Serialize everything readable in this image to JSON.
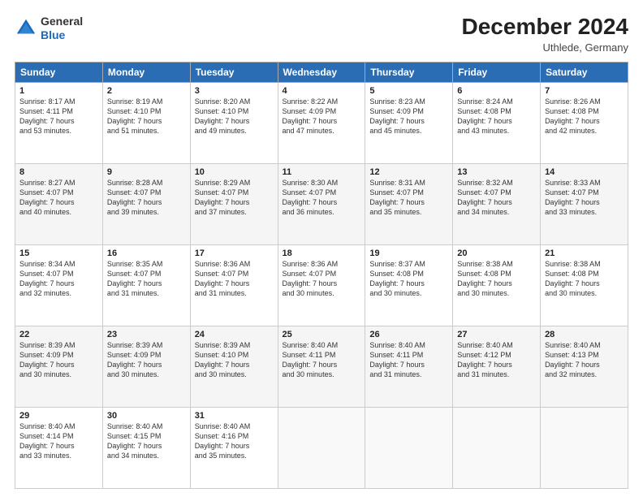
{
  "logo": {
    "line1": "General",
    "line2": "Blue"
  },
  "header": {
    "month": "December 2024",
    "location": "Uthlede, Germany"
  },
  "days": [
    "Sunday",
    "Monday",
    "Tuesday",
    "Wednesday",
    "Thursday",
    "Friday",
    "Saturday"
  ],
  "weeks": [
    [
      {
        "day": 1,
        "sunrise": "8:17 AM",
        "sunset": "4:11 PM",
        "daylight": "7 hours and 53 minutes."
      },
      {
        "day": 2,
        "sunrise": "8:19 AM",
        "sunset": "4:10 PM",
        "daylight": "7 hours and 51 minutes."
      },
      {
        "day": 3,
        "sunrise": "8:20 AM",
        "sunset": "4:10 PM",
        "daylight": "7 hours and 49 minutes."
      },
      {
        "day": 4,
        "sunrise": "8:22 AM",
        "sunset": "4:09 PM",
        "daylight": "7 hours and 47 minutes."
      },
      {
        "day": 5,
        "sunrise": "8:23 AM",
        "sunset": "4:09 PM",
        "daylight": "7 hours and 45 minutes."
      },
      {
        "day": 6,
        "sunrise": "8:24 AM",
        "sunset": "4:08 PM",
        "daylight": "7 hours and 43 minutes."
      },
      {
        "day": 7,
        "sunrise": "8:26 AM",
        "sunset": "4:08 PM",
        "daylight": "7 hours and 42 minutes."
      }
    ],
    [
      {
        "day": 8,
        "sunrise": "8:27 AM",
        "sunset": "4:07 PM",
        "daylight": "7 hours and 40 minutes."
      },
      {
        "day": 9,
        "sunrise": "8:28 AM",
        "sunset": "4:07 PM",
        "daylight": "7 hours and 39 minutes."
      },
      {
        "day": 10,
        "sunrise": "8:29 AM",
        "sunset": "4:07 PM",
        "daylight": "7 hours and 37 minutes."
      },
      {
        "day": 11,
        "sunrise": "8:30 AM",
        "sunset": "4:07 PM",
        "daylight": "7 hours and 36 minutes."
      },
      {
        "day": 12,
        "sunrise": "8:31 AM",
        "sunset": "4:07 PM",
        "daylight": "7 hours and 35 minutes."
      },
      {
        "day": 13,
        "sunrise": "8:32 AM",
        "sunset": "4:07 PM",
        "daylight": "7 hours and 34 minutes."
      },
      {
        "day": 14,
        "sunrise": "8:33 AM",
        "sunset": "4:07 PM",
        "daylight": "7 hours and 33 minutes."
      }
    ],
    [
      {
        "day": 15,
        "sunrise": "8:34 AM",
        "sunset": "4:07 PM",
        "daylight": "7 hours and 32 minutes."
      },
      {
        "day": 16,
        "sunrise": "8:35 AM",
        "sunset": "4:07 PM",
        "daylight": "7 hours and 31 minutes."
      },
      {
        "day": 17,
        "sunrise": "8:36 AM",
        "sunset": "4:07 PM",
        "daylight": "7 hours and 31 minutes."
      },
      {
        "day": 18,
        "sunrise": "8:36 AM",
        "sunset": "4:07 PM",
        "daylight": "7 hours and 30 minutes."
      },
      {
        "day": 19,
        "sunrise": "8:37 AM",
        "sunset": "4:08 PM",
        "daylight": "7 hours and 30 minutes."
      },
      {
        "day": 20,
        "sunrise": "8:38 AM",
        "sunset": "4:08 PM",
        "daylight": "7 hours and 30 minutes."
      },
      {
        "day": 21,
        "sunrise": "8:38 AM",
        "sunset": "4:08 PM",
        "daylight": "7 hours and 30 minutes."
      }
    ],
    [
      {
        "day": 22,
        "sunrise": "8:39 AM",
        "sunset": "4:09 PM",
        "daylight": "7 hours and 30 minutes."
      },
      {
        "day": 23,
        "sunrise": "8:39 AM",
        "sunset": "4:09 PM",
        "daylight": "7 hours and 30 minutes."
      },
      {
        "day": 24,
        "sunrise": "8:39 AM",
        "sunset": "4:10 PM",
        "daylight": "7 hours and 30 minutes."
      },
      {
        "day": 25,
        "sunrise": "8:40 AM",
        "sunset": "4:11 PM",
        "daylight": "7 hours and 30 minutes."
      },
      {
        "day": 26,
        "sunrise": "8:40 AM",
        "sunset": "4:11 PM",
        "daylight": "7 hours and 31 minutes."
      },
      {
        "day": 27,
        "sunrise": "8:40 AM",
        "sunset": "4:12 PM",
        "daylight": "7 hours and 31 minutes."
      },
      {
        "day": 28,
        "sunrise": "8:40 AM",
        "sunset": "4:13 PM",
        "daylight": "7 hours and 32 minutes."
      }
    ],
    [
      {
        "day": 29,
        "sunrise": "8:40 AM",
        "sunset": "4:14 PM",
        "daylight": "7 hours and 33 minutes."
      },
      {
        "day": 30,
        "sunrise": "8:40 AM",
        "sunset": "4:15 PM",
        "daylight": "7 hours and 34 minutes."
      },
      {
        "day": 31,
        "sunrise": "8:40 AM",
        "sunset": "4:16 PM",
        "daylight": "7 hours and 35 minutes."
      },
      null,
      null,
      null,
      null
    ]
  ],
  "labels": {
    "sunrise": "Sunrise:",
    "sunset": "Sunset:",
    "daylight": "Daylight hours"
  }
}
